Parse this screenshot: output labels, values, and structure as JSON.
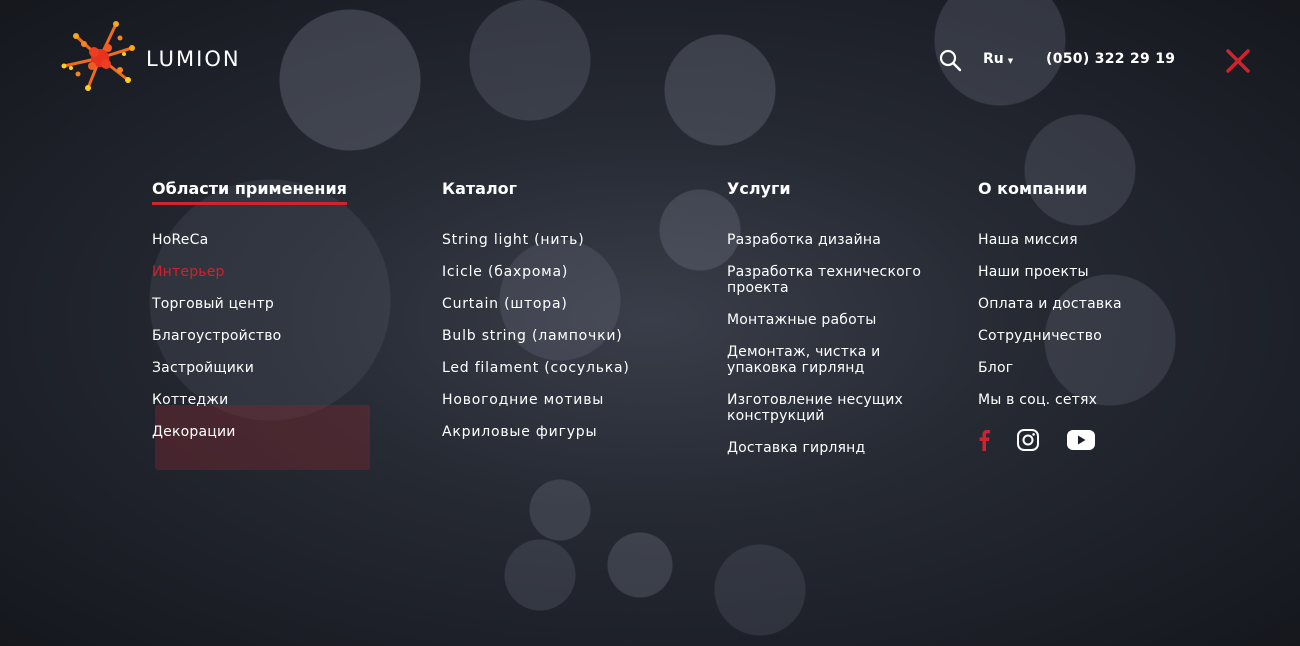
{
  "brand": {
    "name": "LUMION"
  },
  "header": {
    "language": "Ru",
    "phone": "(050) 322 29 19"
  },
  "icons": {
    "search": "search-icon",
    "close": "close-icon",
    "facebook": "facebook-icon",
    "instagram": "instagram-icon",
    "youtube": "youtube-icon",
    "caret": "caret-down-icon"
  },
  "colors": {
    "accent": "#d0232f",
    "text": "#ffffff",
    "background": "#1b1e26"
  },
  "menu": {
    "columns": [
      {
        "title": "Области применения",
        "active": true,
        "items": [
          "HoReCa",
          "Интерьер",
          "Торговый центр",
          "Благоустройство",
          "Застройщики",
          "Коттеджи",
          "Декорации"
        ]
      },
      {
        "title": "Каталог",
        "items": [
          "String light (нить)",
          "Icicle (бахрома)",
          "Curtain (штора)",
          "Bulb string (лампочки)",
          "Led filament (сосулька)",
          "Новогодние мотивы",
          "Акриловые фигуры"
        ]
      },
      {
        "title": "Услуги",
        "items": [
          "Разработка дизайна",
          "Разработка технического проекта",
          "Монтажные работы",
          "Демонтаж, чистка и упаковка гирлянд",
          "Изготовление несущих конструкций",
          "Доставка гирлянд"
        ]
      },
      {
        "title": "О компании",
        "items": [
          "Наша миссия",
          "Наши проекты",
          "Оплата и доставка",
          "Сотрудничество",
          "Блог",
          "Мы в соц. сетях"
        ]
      }
    ]
  }
}
